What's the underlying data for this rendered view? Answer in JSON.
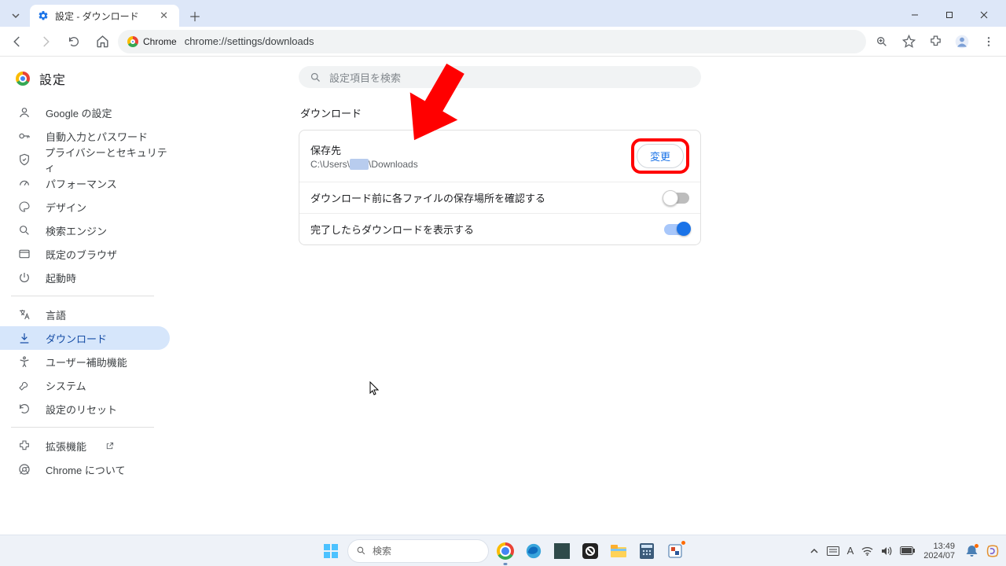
{
  "tab": {
    "title": "設定 - ダウンロード"
  },
  "omnibox": {
    "chip": "Chrome",
    "url": "chrome://settings/downloads"
  },
  "sidebar": {
    "title": "設定",
    "items": [
      {
        "label": "Google の設定"
      },
      {
        "label": "自動入力とパスワード"
      },
      {
        "label": "プライバシーとセキュリティ"
      },
      {
        "label": "パフォーマンス"
      },
      {
        "label": "デザイン"
      },
      {
        "label": "検索エンジン"
      },
      {
        "label": "既定のブラウザ"
      },
      {
        "label": "起動時"
      }
    ],
    "items2": [
      {
        "label": "言語"
      },
      {
        "label": "ダウンロード"
      },
      {
        "label": "ユーザー補助機能"
      },
      {
        "label": "システム"
      },
      {
        "label": "設定のリセット"
      }
    ],
    "items3": [
      {
        "label": "拡張機能"
      },
      {
        "label": "Chrome について"
      }
    ]
  },
  "search_placeholder": "設定項目を検索",
  "section": {
    "title": "ダウンロード",
    "location_label": "保存先",
    "location_value_prefix": "C:\\Users\\",
    "location_value_hidden": "xxxx",
    "location_value_suffix": "\\Downloads",
    "change_button": "変更",
    "ask_each": "ダウンロード前に各ファイルの保存場所を確認する",
    "ask_each_on": false,
    "show_when_done": "完了したらダウンロードを表示する",
    "show_when_done_on": true
  },
  "taskbar": {
    "search_placeholder": "検索",
    "clock_time": "13:49",
    "clock_date": "2024/07"
  }
}
